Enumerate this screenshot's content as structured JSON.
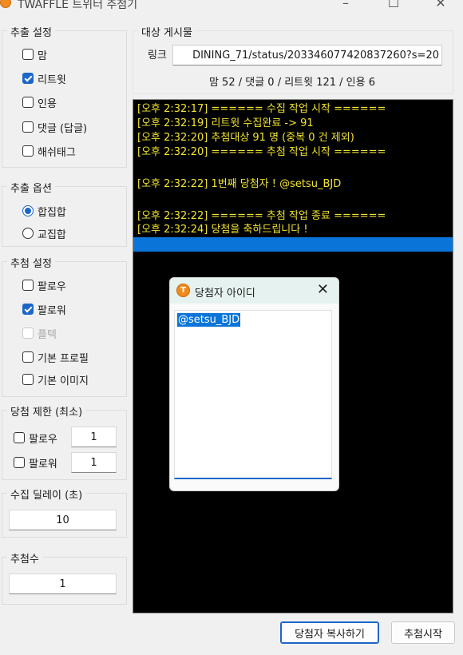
{
  "window": {
    "title": "TWAFFLE 트위터 추첨기",
    "minimize": "–",
    "maximize": "☐",
    "close": "✕"
  },
  "extract_settings": {
    "title": "추출 설정",
    "items": [
      {
        "label": "맘",
        "checked": false
      },
      {
        "label": "리트윗",
        "checked": true
      },
      {
        "label": "인용",
        "checked": false
      },
      {
        "label": "댓글 (답글)",
        "checked": false
      },
      {
        "label": "해쉬태그",
        "checked": false
      }
    ]
  },
  "extract_options": {
    "title": "추출 옵션",
    "items": [
      {
        "label": "합집합",
        "selected": true
      },
      {
        "label": "교집합",
        "selected": false
      }
    ]
  },
  "draw_settings": {
    "title": "추첨 설정",
    "items": [
      {
        "label": "팔로우",
        "checked": false
      },
      {
        "label": "팔로워",
        "checked": true
      },
      {
        "label": "플텍",
        "checked": false,
        "disabled": true
      },
      {
        "label": "기본 프로필",
        "checked": false
      },
      {
        "label": "기본 이미지",
        "checked": false
      }
    ]
  },
  "win_limit": {
    "title": "당첨 제한 (최소)",
    "follow_label": "팔로우",
    "follow_value": "1",
    "follower_label": "팔로워",
    "follower_value": "1"
  },
  "delay": {
    "title": "수집 딜레이 (초)",
    "value": "10"
  },
  "draw_count": {
    "title": "추첨수",
    "value": "1"
  },
  "target_post": {
    "title": "대상 게시물",
    "link_label": "링크",
    "link_value": "DINING_71/status/203346077420837260?s=20",
    "stats": "맘 52 / 댓글 0 / 리트윗 121 / 인용 6"
  },
  "log": {
    "lines": [
      "[오후 2:32:17] ====== 수집 작업 시작 ======",
      "[오후 2:32:19] 리트윗 수집완료 -> 91",
      "[오후 2:32:20] 추첨대상 91 명 (중복 0 건 제외)",
      "[오후 2:32:20] ====== 추첨 작업 시작 ======",
      "[오후 2:32:22] 1번째 당첨자 ! @setsu_BJD",
      "[오후 2:32:22] ====== 추첨 작업 종료 ======",
      "[오후 2:32:24] 당첨을 축하드립니다 !"
    ],
    "text_color": "#f2e530",
    "selection_color": "#0a74d8"
  },
  "buttons": {
    "copy_winner": "당첨자 복사하기",
    "start_draw": "추첨시작"
  },
  "dialog": {
    "title": "당첨자 아이디",
    "icon_letter": "T",
    "close": "✕",
    "content": "@setsu_BJD"
  }
}
